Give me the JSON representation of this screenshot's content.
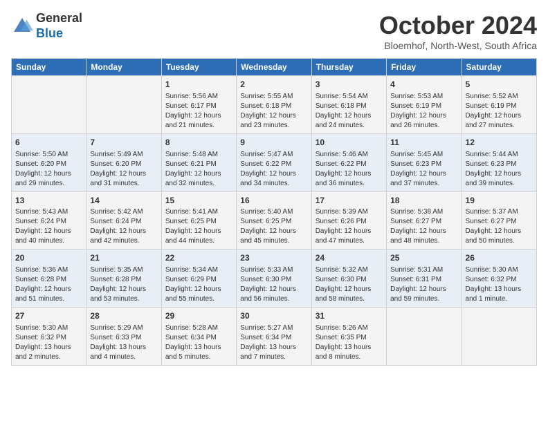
{
  "logo": {
    "general": "General",
    "blue": "Blue"
  },
  "header": {
    "month": "October 2024",
    "location": "Bloemhof, North-West, South Africa"
  },
  "weekdays": [
    "Sunday",
    "Monday",
    "Tuesday",
    "Wednesday",
    "Thursday",
    "Friday",
    "Saturday"
  ],
  "weeks": [
    [
      {
        "day": "",
        "info": ""
      },
      {
        "day": "",
        "info": ""
      },
      {
        "day": "1",
        "info": "Sunrise: 5:56 AM\nSunset: 6:17 PM\nDaylight: 12 hours and 21 minutes."
      },
      {
        "day": "2",
        "info": "Sunrise: 5:55 AM\nSunset: 6:18 PM\nDaylight: 12 hours and 23 minutes."
      },
      {
        "day": "3",
        "info": "Sunrise: 5:54 AM\nSunset: 6:18 PM\nDaylight: 12 hours and 24 minutes."
      },
      {
        "day": "4",
        "info": "Sunrise: 5:53 AM\nSunset: 6:19 PM\nDaylight: 12 hours and 26 minutes."
      },
      {
        "day": "5",
        "info": "Sunrise: 5:52 AM\nSunset: 6:19 PM\nDaylight: 12 hours and 27 minutes."
      }
    ],
    [
      {
        "day": "6",
        "info": "Sunrise: 5:50 AM\nSunset: 6:20 PM\nDaylight: 12 hours and 29 minutes."
      },
      {
        "day": "7",
        "info": "Sunrise: 5:49 AM\nSunset: 6:20 PM\nDaylight: 12 hours and 31 minutes."
      },
      {
        "day": "8",
        "info": "Sunrise: 5:48 AM\nSunset: 6:21 PM\nDaylight: 12 hours and 32 minutes."
      },
      {
        "day": "9",
        "info": "Sunrise: 5:47 AM\nSunset: 6:22 PM\nDaylight: 12 hours and 34 minutes."
      },
      {
        "day": "10",
        "info": "Sunrise: 5:46 AM\nSunset: 6:22 PM\nDaylight: 12 hours and 36 minutes."
      },
      {
        "day": "11",
        "info": "Sunrise: 5:45 AM\nSunset: 6:23 PM\nDaylight: 12 hours and 37 minutes."
      },
      {
        "day": "12",
        "info": "Sunrise: 5:44 AM\nSunset: 6:23 PM\nDaylight: 12 hours and 39 minutes."
      }
    ],
    [
      {
        "day": "13",
        "info": "Sunrise: 5:43 AM\nSunset: 6:24 PM\nDaylight: 12 hours and 40 minutes."
      },
      {
        "day": "14",
        "info": "Sunrise: 5:42 AM\nSunset: 6:24 PM\nDaylight: 12 hours and 42 minutes."
      },
      {
        "day": "15",
        "info": "Sunrise: 5:41 AM\nSunset: 6:25 PM\nDaylight: 12 hours and 44 minutes."
      },
      {
        "day": "16",
        "info": "Sunrise: 5:40 AM\nSunset: 6:25 PM\nDaylight: 12 hours and 45 minutes."
      },
      {
        "day": "17",
        "info": "Sunrise: 5:39 AM\nSunset: 6:26 PM\nDaylight: 12 hours and 47 minutes."
      },
      {
        "day": "18",
        "info": "Sunrise: 5:38 AM\nSunset: 6:27 PM\nDaylight: 12 hours and 48 minutes."
      },
      {
        "day": "19",
        "info": "Sunrise: 5:37 AM\nSunset: 6:27 PM\nDaylight: 12 hours and 50 minutes."
      }
    ],
    [
      {
        "day": "20",
        "info": "Sunrise: 5:36 AM\nSunset: 6:28 PM\nDaylight: 12 hours and 51 minutes."
      },
      {
        "day": "21",
        "info": "Sunrise: 5:35 AM\nSunset: 6:28 PM\nDaylight: 12 hours and 53 minutes."
      },
      {
        "day": "22",
        "info": "Sunrise: 5:34 AM\nSunset: 6:29 PM\nDaylight: 12 hours and 55 minutes."
      },
      {
        "day": "23",
        "info": "Sunrise: 5:33 AM\nSunset: 6:30 PM\nDaylight: 12 hours and 56 minutes."
      },
      {
        "day": "24",
        "info": "Sunrise: 5:32 AM\nSunset: 6:30 PM\nDaylight: 12 hours and 58 minutes."
      },
      {
        "day": "25",
        "info": "Sunrise: 5:31 AM\nSunset: 6:31 PM\nDaylight: 12 hours and 59 minutes."
      },
      {
        "day": "26",
        "info": "Sunrise: 5:30 AM\nSunset: 6:32 PM\nDaylight: 13 hours and 1 minute."
      }
    ],
    [
      {
        "day": "27",
        "info": "Sunrise: 5:30 AM\nSunset: 6:32 PM\nDaylight: 13 hours and 2 minutes."
      },
      {
        "day": "28",
        "info": "Sunrise: 5:29 AM\nSunset: 6:33 PM\nDaylight: 13 hours and 4 minutes."
      },
      {
        "day": "29",
        "info": "Sunrise: 5:28 AM\nSunset: 6:34 PM\nDaylight: 13 hours and 5 minutes."
      },
      {
        "day": "30",
        "info": "Sunrise: 5:27 AM\nSunset: 6:34 PM\nDaylight: 13 hours and 7 minutes."
      },
      {
        "day": "31",
        "info": "Sunrise: 5:26 AM\nSunset: 6:35 PM\nDaylight: 13 hours and 8 minutes."
      },
      {
        "day": "",
        "info": ""
      },
      {
        "day": "",
        "info": ""
      }
    ]
  ]
}
